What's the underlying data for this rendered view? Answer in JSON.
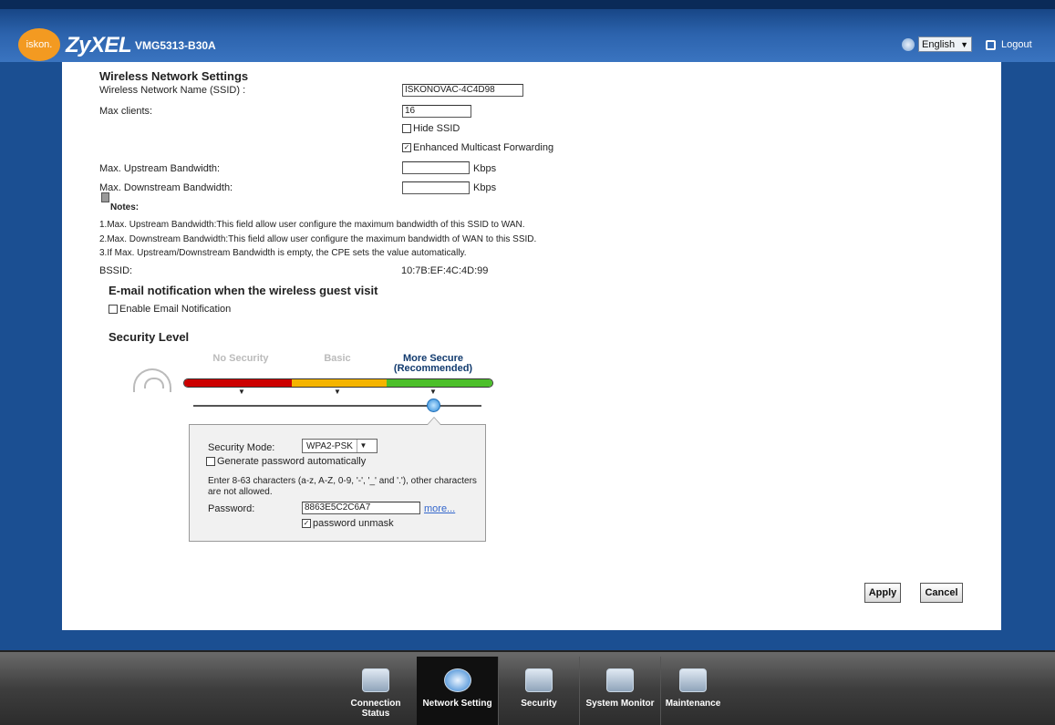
{
  "header": {
    "brand_badge": "iskon.",
    "brand": "ZyXEL",
    "model": "VMG5313-B30A",
    "language": "English",
    "logout_label": "Logout"
  },
  "wireless": {
    "section_title": "Wireless Network Settings",
    "ssid_label": "Wireless Network Name (SSID) :",
    "ssid_value": "ISKONOVAC-4C4D98",
    "max_clients_label": "Max clients:",
    "max_clients_value": "16",
    "hide_ssid_label": "Hide SSID",
    "multicast_label": "Enhanced Multicast Forwarding",
    "upstream_label": "Max. Upstream Bandwidth:",
    "upstream_value": "",
    "upstream_unit": "Kbps",
    "downstream_label": "Max. Downstream Bandwidth:",
    "downstream_value": "",
    "downstream_unit": "Kbps",
    "notes_title": "Notes:",
    "notes": [
      "1.Max. Upstream Bandwidth:This field allow user configure the maximum bandwidth of this SSID to WAN.",
      "2.Max. Downstream Bandwidth:This field allow user configure the maximum bandwidth of WAN to this SSID.",
      "3.If Max. Upstream/Downstream Bandwidth is empty, the CPE sets the value automatically."
    ],
    "bssid_label": "BSSID:",
    "bssid_value": "10:7B:EF:4C:4D:99"
  },
  "email": {
    "title": "E-mail notification when the wireless guest visit",
    "enable_label": "Enable Email Notification"
  },
  "security": {
    "title": "Security Level",
    "levels": [
      "No Security",
      "Basic",
      "More Secure"
    ],
    "recommended": "(Recommended)",
    "mode_label": "Security Mode:",
    "mode_value": "WPA2-PSK",
    "generate_label": "Generate password automatically",
    "hint_line1": "Enter 8-63 characters (a-z, A-Z, 0-9, '-', '_' and '.'), other characters",
    "hint_line2": "are not allowed.",
    "password_label": "Password:",
    "password_value": "8863E5C2C6A7",
    "more_link": "more...",
    "unmask_label": "password unmask"
  },
  "actions": {
    "apply": "Apply",
    "cancel": "Cancel"
  },
  "nav": {
    "items": [
      "Connection Status",
      "Network Setting",
      "Security",
      "System Monitor",
      "Maintenance"
    ]
  }
}
